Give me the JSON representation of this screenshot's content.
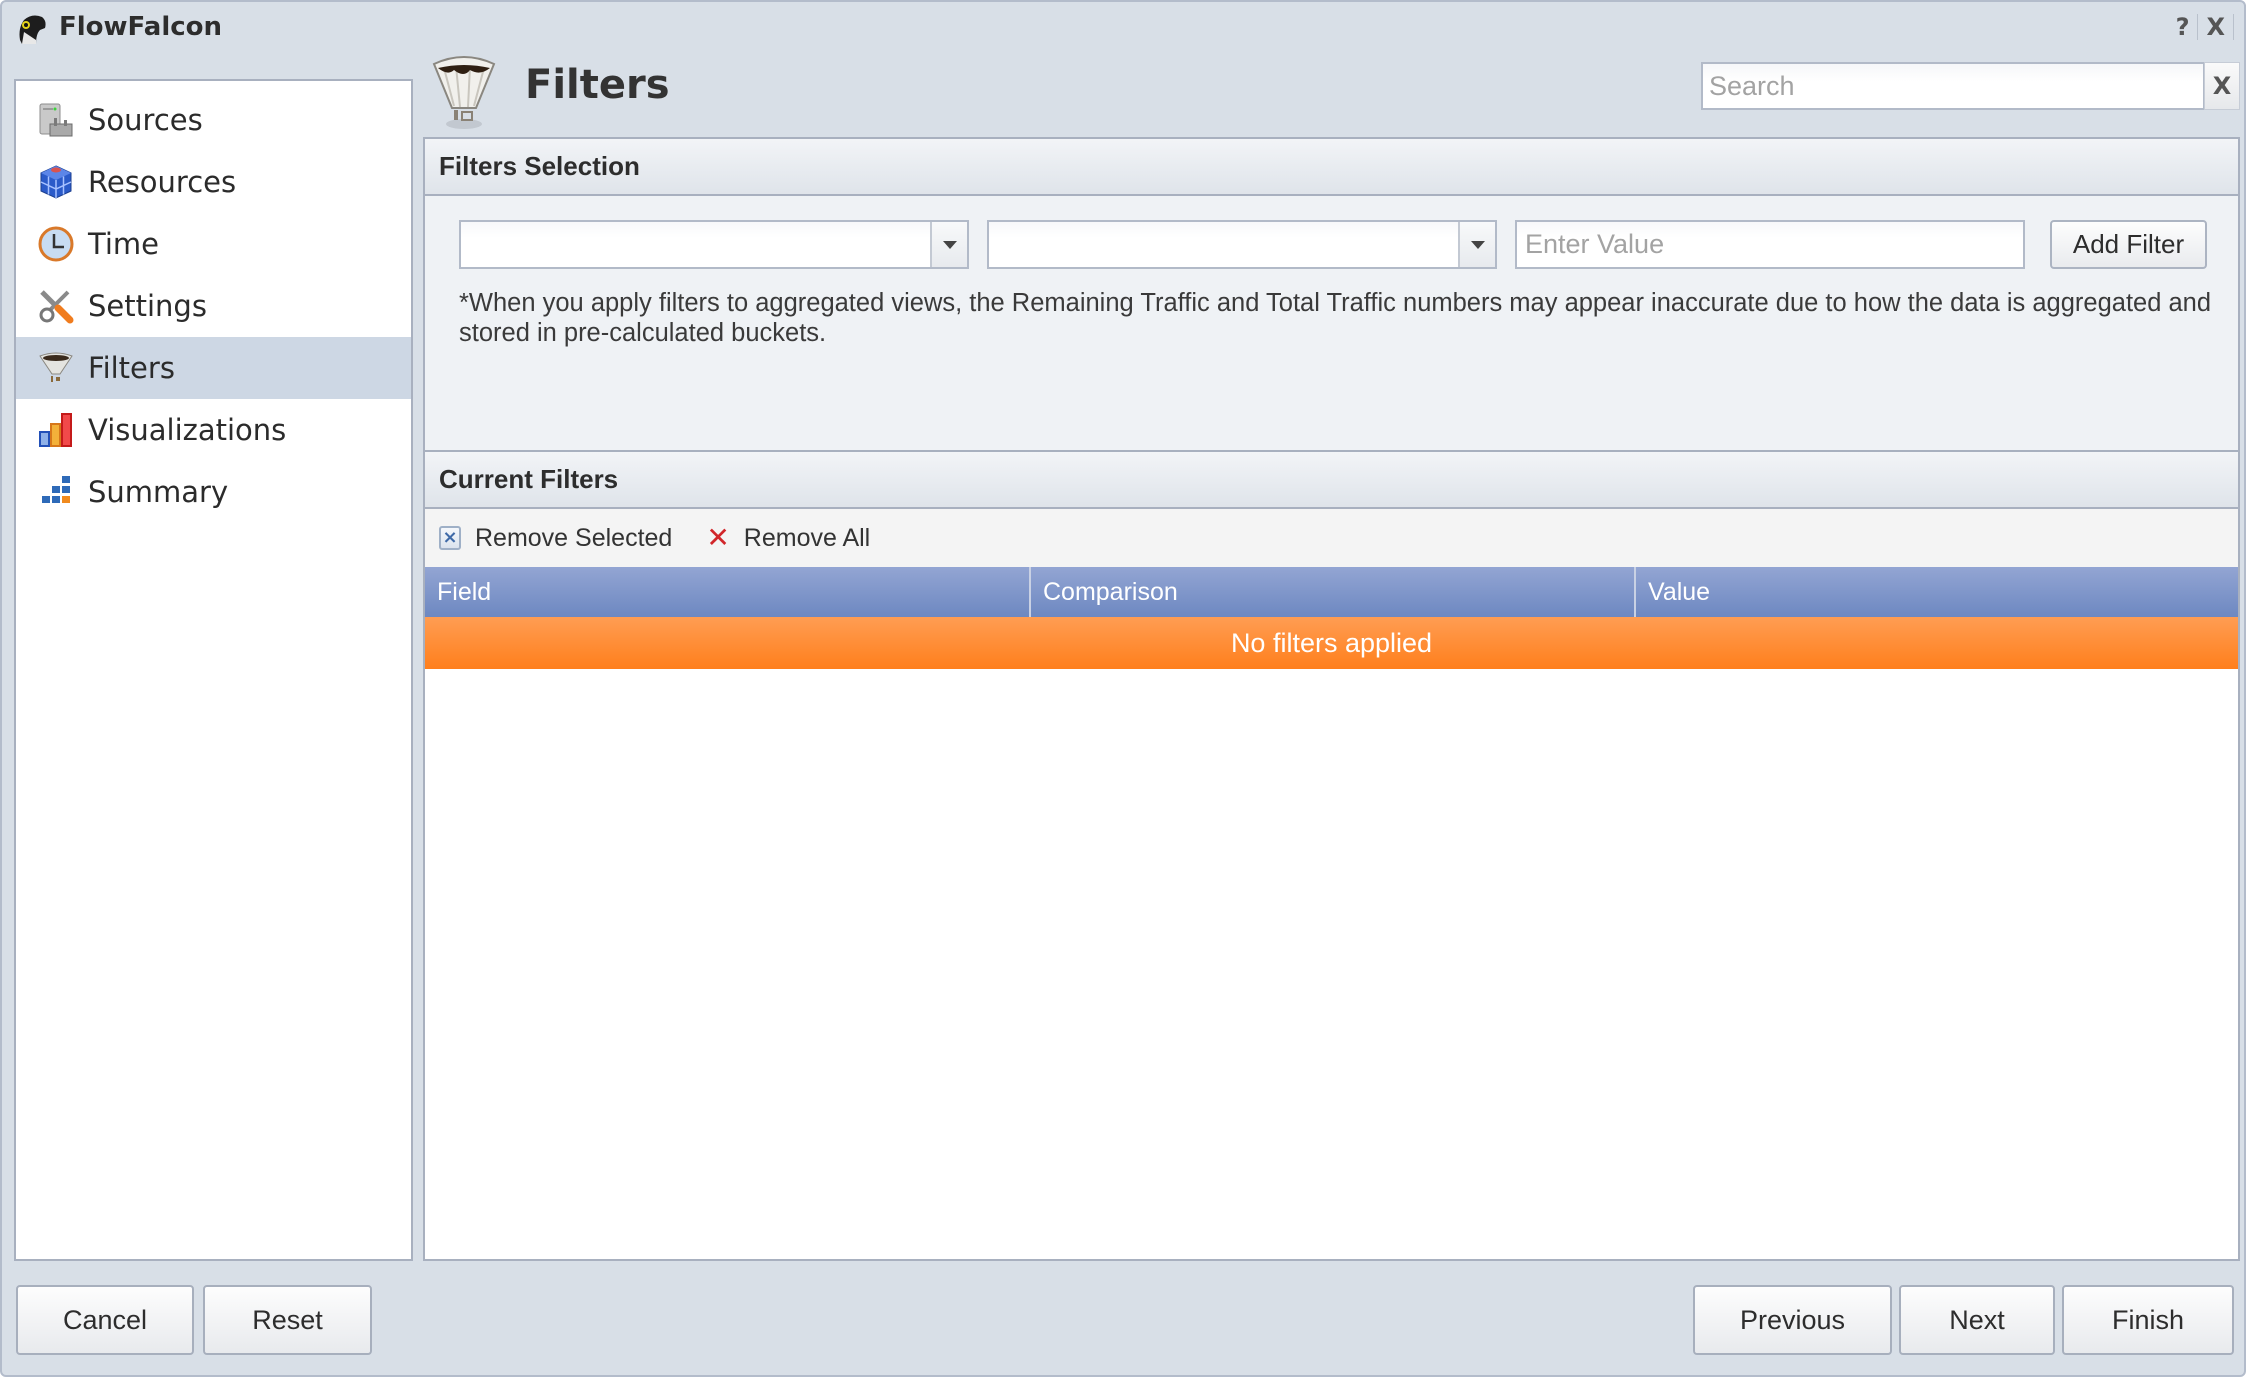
{
  "window": {
    "title": "FlowFalcon",
    "help_label": "?",
    "close_label": "X"
  },
  "sidebar": {
    "items": [
      {
        "label": "Sources",
        "icon": "server-icon",
        "active": false
      },
      {
        "label": "Resources",
        "icon": "cube-icon",
        "active": false
      },
      {
        "label": "Time",
        "icon": "clock-icon",
        "active": false
      },
      {
        "label": "Settings",
        "icon": "tools-icon",
        "active": false
      },
      {
        "label": "Filters",
        "icon": "funnel-icon",
        "active": true
      },
      {
        "label": "Visualizations",
        "icon": "bar-chart-icon",
        "active": false
      },
      {
        "label": "Summary",
        "icon": "summary-blocks-icon",
        "active": false
      }
    ]
  },
  "header": {
    "title": "Filters",
    "icon": "funnel-icon",
    "search_placeholder": "Search",
    "search_value": "",
    "search_clear_label": "X"
  },
  "filters_selection": {
    "title": "Filters Selection",
    "field_combo_value": "",
    "comparison_combo_value": "",
    "value_placeholder": "Enter Value",
    "value_input": "",
    "add_filter_label": "Add Filter",
    "note": "*When you apply filters to aggregated views, the Remaining Traffic and Total Traffic numbers may appear inaccurate due to how the data is aggregated and stored in pre-calculated buckets."
  },
  "current_filters": {
    "title": "Current Filters",
    "remove_selected_label": "Remove Selected",
    "remove_all_label": "Remove All",
    "columns": [
      "Field",
      "Comparison",
      "Value"
    ],
    "rows": [],
    "empty_message": "No filters applied"
  },
  "footer": {
    "cancel_label": "Cancel",
    "reset_label": "Reset",
    "previous_label": "Previous",
    "next_label": "Next",
    "finish_label": "Finish"
  },
  "colors": {
    "accent_header": "#6d88c1",
    "empty_row": "#ff7f1c",
    "selected_nav": "#cdd7e4",
    "remove_all_x": "#d1262a"
  }
}
